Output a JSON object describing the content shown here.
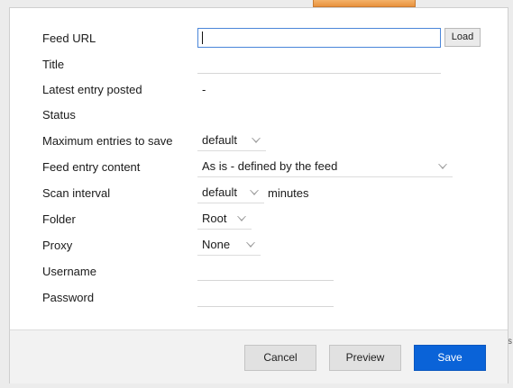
{
  "form": {
    "feed_url": {
      "label": "Feed URL",
      "value": "",
      "load_label": "Load"
    },
    "title": {
      "label": "Title",
      "value": ""
    },
    "latest_entry": {
      "label": "Latest entry posted",
      "value": "-"
    },
    "status": {
      "label": "Status",
      "value": ""
    },
    "max_entries": {
      "label": "Maximum entries to save",
      "value": "default"
    },
    "entry_content": {
      "label": "Feed entry content",
      "value": "As is - defined by the feed"
    },
    "scan_interval": {
      "label": "Scan interval",
      "value": "default",
      "unit": "minutes"
    },
    "folder": {
      "label": "Folder",
      "value": "Root"
    },
    "proxy": {
      "label": "Proxy",
      "value": "None"
    },
    "username": {
      "label": "Username",
      "value": ""
    },
    "password": {
      "label": "Password",
      "value": ""
    }
  },
  "footer": {
    "cancel_label": "Cancel",
    "preview_label": "Preview",
    "save_label": "Save"
  },
  "colors": {
    "primary": "#0a63d8",
    "focus_border": "#4a86d9",
    "background": "#ececec"
  }
}
